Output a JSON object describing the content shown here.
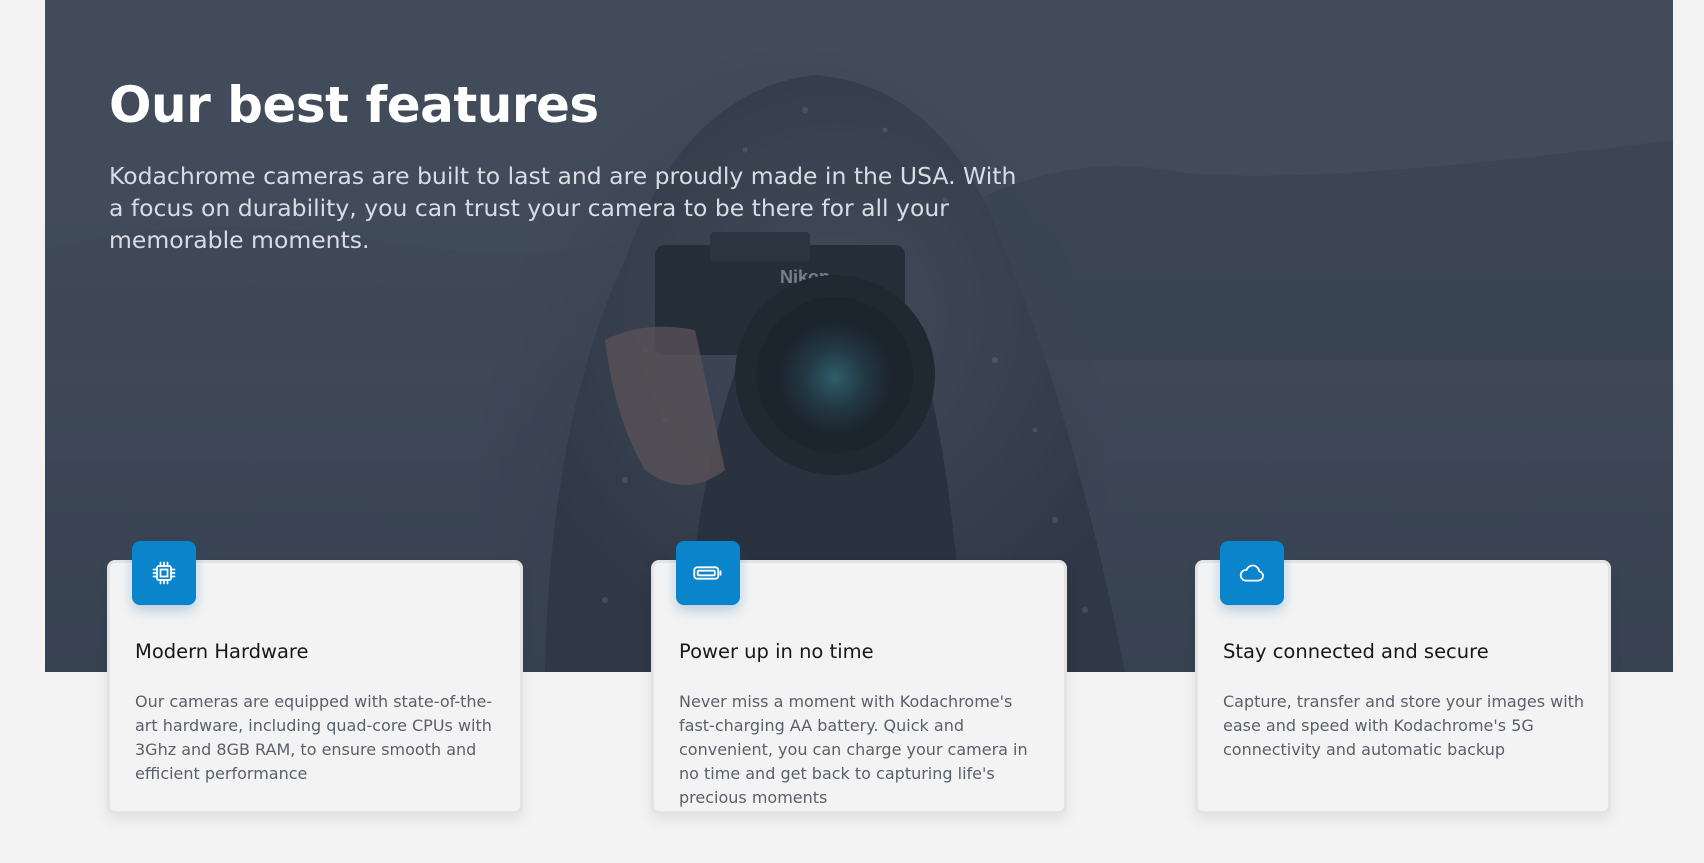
{
  "hero": {
    "title": "Our best features",
    "description": "Kodachrome cameras are built to last and are proudly made in the USA. With a focus on durability, you can trust your camera to be there for all your memorable moments.",
    "image": "woman-with-nikon-camera-in-snow-photo"
  },
  "features": [
    {
      "icon": "cpu-chip-icon",
      "title": "Modern Hardware",
      "body": "Our cameras are equipped with state-of-the-art hardware, including quad-core CPUs with 3Ghz and 8GB RAM, to ensure smooth and efficient performance"
    },
    {
      "icon": "battery-icon",
      "title": "Power up in no time",
      "body": "Never miss a moment with Kodachrome's fast-charging AA battery. Quick and convenient, you can charge your camera in no time and get back to capturing life's precious moments"
    },
    {
      "icon": "cloud-icon",
      "title": "Stay connected and secure",
      "body": "Capture, transfer and store your images with ease and speed with Kodachrome's 5G connectivity and automatic backup"
    }
  ],
  "colors": {
    "accent": "#0a85cc",
    "page_background": "#f3f3f3",
    "hero_overlay": "#374151"
  }
}
